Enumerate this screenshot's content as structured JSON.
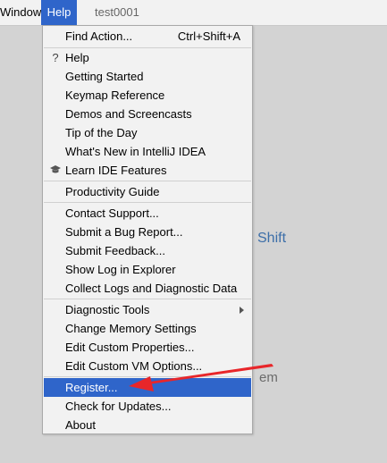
{
  "menubar": {
    "window_label": "Window",
    "help_label": "Help",
    "tab_label": "test0001"
  },
  "background": {
    "shift_text": "Shift",
    "fragment_text": "em"
  },
  "help_menu": {
    "find_action": {
      "label": "Find Action...",
      "shortcut": "Ctrl+Shift+A"
    },
    "help": {
      "label": "Help"
    },
    "getting_started": {
      "label": "Getting Started"
    },
    "keymap_reference": {
      "label": "Keymap Reference"
    },
    "demos_screencasts": {
      "label": "Demos and Screencasts"
    },
    "tip_of_the_day": {
      "label": "Tip of the Day"
    },
    "whats_new": {
      "label": "What's New in IntelliJ IDEA"
    },
    "learn_ide": {
      "label": "Learn IDE Features"
    },
    "productivity_guide": {
      "label": "Productivity Guide"
    },
    "contact_support": {
      "label": "Contact Support..."
    },
    "submit_bug": {
      "label": "Submit a Bug Report..."
    },
    "submit_feedback": {
      "label": "Submit Feedback..."
    },
    "show_log": {
      "label": "Show Log in Explorer"
    },
    "collect_logs": {
      "label": "Collect Logs and Diagnostic Data"
    },
    "diagnostic_tools": {
      "label": "Diagnostic Tools"
    },
    "change_memory": {
      "label": "Change Memory Settings"
    },
    "edit_properties": {
      "label": "Edit Custom Properties..."
    },
    "edit_vm_options": {
      "label": "Edit Custom VM Options..."
    },
    "register": {
      "label": "Register..."
    },
    "check_updates": {
      "label": "Check for Updates..."
    },
    "about": {
      "label": "About"
    }
  },
  "icons": {
    "help": "question-mark",
    "learn_ide": "graduation-cap",
    "diagnostic_tools": "submenu-arrow"
  },
  "colors": {
    "menu_background": "#f2f2f2",
    "selection": "#2f65ca",
    "annotation_arrow": "#e8262a",
    "ide_background": "#d3d3d3"
  },
  "state": {
    "open_menu": "Help",
    "highlighted_item": "Register..."
  }
}
